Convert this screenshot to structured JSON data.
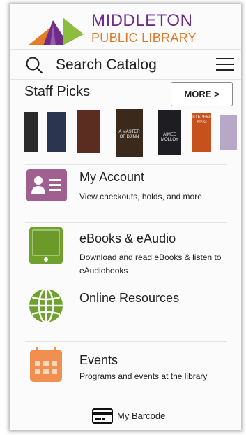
{
  "header": {
    "logo_line1": "MIDDLETON",
    "logo_line2": "PUBLIC LIBRARY",
    "logo_colors": [
      "#e57c2a",
      "#6d2c87",
      "#8cbd3f"
    ]
  },
  "search": {
    "label": "Search Catalog",
    "icon": "search-icon",
    "menu_icon": "hamburger-menu-icon"
  },
  "staff_picks": {
    "title": "Staff Picks",
    "more_label": "MORE >",
    "covers": [
      {
        "title": "",
        "color": "#2b2b2b"
      },
      {
        "title": "",
        "color": "#2c3550"
      },
      {
        "title": "",
        "color": "#5b2c20"
      },
      {
        "title": "A MASTER OF DJINN",
        "color": "#3b2a1c"
      },
      {
        "title": "AIMEE MOLLOY",
        "color": "#1e1e22"
      },
      {
        "title": "STEPHEN KING",
        "color": "#c7511d"
      },
      {
        "title": "",
        "color": "#b7a8c8"
      }
    ]
  },
  "menu": [
    {
      "key": "account",
      "title": "My Account",
      "desc": "View checkouts, holds, and more",
      "icon": "account-card-icon",
      "color": "#a0608f"
    },
    {
      "key": "ebooks",
      "title": "eBooks & eAudio",
      "desc": "Download and read eBooks & listen to eAudiobooks",
      "icon": "tablet-icon",
      "color": "#6fa12c"
    },
    {
      "key": "online",
      "title": "Online Resources",
      "desc": "",
      "icon": "globe-icon",
      "color": "#6fa12c"
    },
    {
      "key": "events",
      "title": "Events",
      "desc": "Programs and events at the library",
      "icon": "calendar-icon",
      "color": "#f08f4f"
    }
  ],
  "footer": {
    "barcode_label": "My Barcode",
    "icon": "card-icon"
  }
}
